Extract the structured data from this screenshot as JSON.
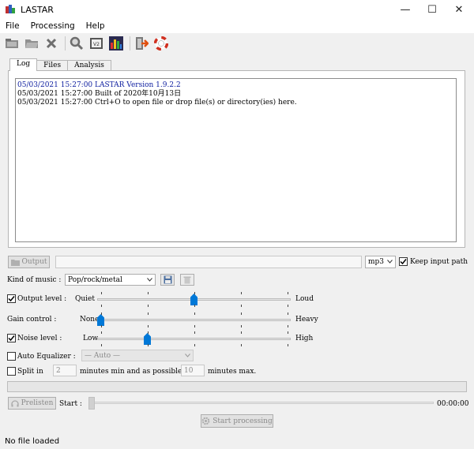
{
  "window": {
    "title": "LASTAR"
  },
  "menu": [
    "File",
    "Processing",
    "Help"
  ],
  "toolbar": {
    "icons": [
      "open-file-icon",
      "open-folder-icon",
      "remove-icon",
      "search-icon",
      "tag-icon",
      "equalizer-icon",
      "exit-icon",
      "help-icon"
    ]
  },
  "tabs": [
    {
      "label": "Log",
      "active": true
    },
    {
      "label": "Files"
    },
    {
      "label": "Analysis"
    }
  ],
  "log": [
    "05/03/2021 15:27:00 LASTAR Version 1.9.2.2",
    "05/03/2021 15:27:00 Built of 2020年10月13日",
    "05/03/2021 15:27:00 Ctrl+O to open file or drop file(s) or directory(ies) here."
  ],
  "output": {
    "button": "Output",
    "path_value": "",
    "format": "mp3",
    "keep_path_label": "Keep input path",
    "keep_path_checked": true
  },
  "kind": {
    "label": "Kind of music :",
    "value": "Pop/rock/metal"
  },
  "output_level": {
    "label": "Output level :",
    "checked": true,
    "min_label": "Quiet",
    "max_label": "Loud",
    "value": 0.5
  },
  "gain_control": {
    "label": "Gain control :",
    "min_label": "None",
    "max_label": "Heavy",
    "value": 0.0
  },
  "noise_level": {
    "label": "Noise level :",
    "checked": true,
    "min_label": "Low",
    "max_label": "High",
    "value": 0.25
  },
  "auto_eq": {
    "label": "Auto Equalizer :",
    "checked": false,
    "value": "— Auto —"
  },
  "split": {
    "label": "Split in",
    "checked": false,
    "min_value": "2",
    "middle_text": "minutes min and as possible",
    "max_value": "10",
    "end_text": "minutes max."
  },
  "prelisten": {
    "button": "Prelisten",
    "start_label": "Start :",
    "time": "00:00:00"
  },
  "process": {
    "button": "Start processing"
  },
  "status": {
    "text": "No file loaded"
  },
  "colors": {
    "accent": "#0078d7",
    "log_blue": "#1020a0"
  }
}
